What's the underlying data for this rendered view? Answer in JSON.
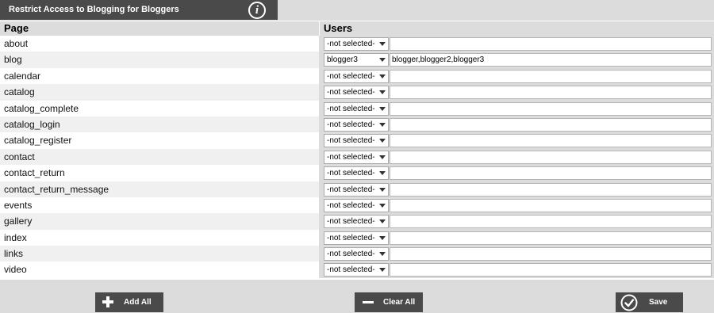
{
  "header": {
    "title": "Restrict Access to Blogging for Bloggers",
    "info_icon": "info-icon",
    "info_glyph": "i"
  },
  "table": {
    "columns": {
      "page": "Page",
      "users": "Users"
    },
    "rows": [
      {
        "page": "about",
        "select": "-not selected-",
        "users": ""
      },
      {
        "page": "blog",
        "select": "blogger3",
        "users": "blogger,blogger2,blogger3"
      },
      {
        "page": "calendar",
        "select": "-not selected-",
        "users": ""
      },
      {
        "page": "catalog",
        "select": "-not selected-",
        "users": ""
      },
      {
        "page": "catalog_complete",
        "select": "-not selected-",
        "users": ""
      },
      {
        "page": "catalog_login",
        "select": "-not selected-",
        "users": ""
      },
      {
        "page": "catalog_register",
        "select": "-not selected-",
        "users": ""
      },
      {
        "page": "contact",
        "select": "-not selected-",
        "users": ""
      },
      {
        "page": "contact_return",
        "select": "-not selected-",
        "users": ""
      },
      {
        "page": "contact_return_message",
        "select": "-not selected-",
        "users": ""
      },
      {
        "page": "events",
        "select": "-not selected-",
        "users": ""
      },
      {
        "page": "gallery",
        "select": "-not selected-",
        "users": ""
      },
      {
        "page": "index",
        "select": "-not selected-",
        "users": ""
      },
      {
        "page": "links",
        "select": "-not selected-",
        "users": ""
      },
      {
        "page": "video",
        "select": "-not selected-",
        "users": ""
      }
    ]
  },
  "footer": {
    "add_all": "Add All",
    "clear_all": "Clear All",
    "save": "Save"
  },
  "colors": {
    "bar": "#4a4a4a",
    "panel": "#dcdcdc",
    "row_alt": "#f0f0f0"
  }
}
